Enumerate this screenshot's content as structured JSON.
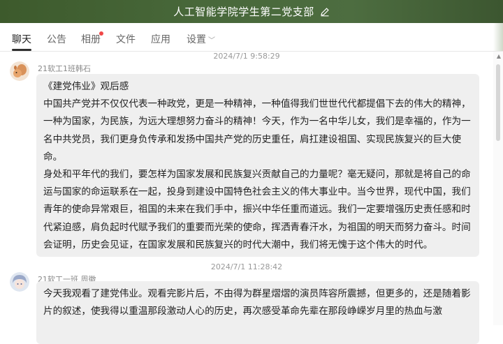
{
  "window": {
    "title": "人工智能学院学生第二党支部"
  },
  "tabs": [
    {
      "label": "聊天",
      "active": true
    },
    {
      "label": "公告"
    },
    {
      "label": "相册",
      "badge": true
    },
    {
      "label": "文件"
    },
    {
      "label": "应用"
    },
    {
      "label": "设置",
      "has_dropdown": true
    }
  ],
  "messages": [
    {
      "timestamp": "2024/7/1 9:58:29",
      "sender": "21软工1班韩石",
      "paragraphs": [
        "《建党伟业》观后感",
        "  中国共产党并不仅仅代表一种政党，更是一种精神，一种值得我们世世代代都提倡下去的伟大的精神，一种为国家，为民族，为远大理想努力奋斗的精神！今天，作为一名中华儿女，我们是幸福的，作为一名中共党员，我们更身负传承和发扬中国共产党的历史重任，肩扛建设祖国、实现民族复兴的巨大使命。",
        "  身处和平年代的我们，要怎样为国家发展和民族复兴贡献自己的力量呢？毫无疑问，那就是将自己的命运与国家的命运联系在一起，投身到建设中国特色社会主义的伟大事业中。当今世界，现代中国，我们青年的使命异常艰巨，祖国的未来在我们手中，振兴中华任重而道远。我们一定要增强历史责任感和时代紧迫感，肩负起时代赋予我们的重要而光荣的使命，挥洒青春汗水，为祖国的明天而努力奋斗。时间会证明，历史会见证，在国家发展和民族复兴的时代大潮中，我们将无愧于这个伟大的时代。"
      ]
    },
    {
      "timestamp": "2024/7/1 11:28:42",
      "sender": "21软工一班  周徽",
      "paragraphs": [
        "今天我观看了建党伟业。观看完影片后，不由得为群星熠熠的演员阵容所震撼，但更多的，还是随着影片的叙述，使我得以重温那段激动人心的历史，再次感受革命先辈在那段峥嵘岁月里的热血与激"
      ]
    }
  ],
  "colors": {
    "titlebar": "#48683a",
    "bubble": "#efefef",
    "badge": "#f04848"
  },
  "icons": {
    "title_edit": "pencil-icon",
    "settings_dropdown": "chevron-down-icon"
  }
}
